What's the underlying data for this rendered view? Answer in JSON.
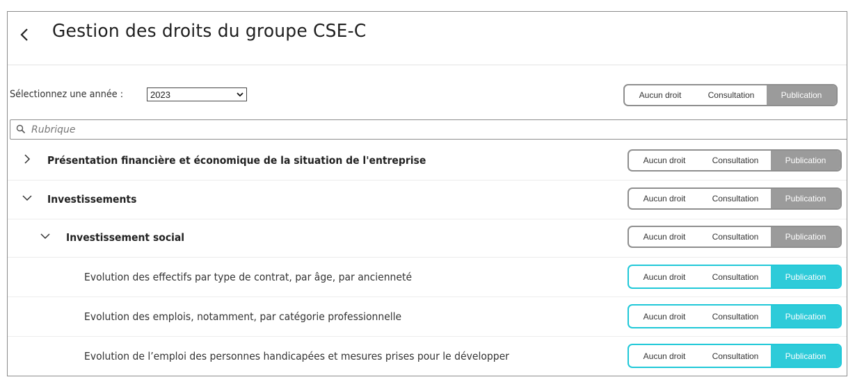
{
  "header": {
    "title": "Gestion des droits du groupe CSE-C",
    "back_icon": "chevron-left-icon"
  },
  "year": {
    "label": "Sélectionnez une année :",
    "selected": "2023"
  },
  "search": {
    "placeholder": "Rubrique"
  },
  "rights": {
    "none": "Aucun droit",
    "view": "Consultation",
    "publish": "Publication"
  },
  "colors": {
    "accent": "#2ecbd9",
    "inactive": "#9b9b9b"
  },
  "rows": [
    {
      "label": "Présentation financière et économique de la situation de l'entreprise",
      "state": "collapsed",
      "level": 0,
      "selected": "Publication"
    },
    {
      "label": "Investissements",
      "state": "expanded",
      "level": 0,
      "selected": "Publication"
    },
    {
      "label": "Investissement social",
      "state": "expanded",
      "level": 1,
      "selected": "Publication"
    },
    {
      "label": "Evolution des effectifs par type de contrat, par âge, par ancienneté",
      "state": "leaf",
      "level": 2,
      "selected": "Publication"
    },
    {
      "label": "Evolution des emplois, notamment, par catégorie professionnelle",
      "state": "leaf",
      "level": 2,
      "selected": "Publication"
    },
    {
      "label": "Evolution de l’emploi des personnes handicapées et mesures prises pour le développer",
      "state": "leaf",
      "level": 2,
      "selected": "Publication"
    }
  ]
}
